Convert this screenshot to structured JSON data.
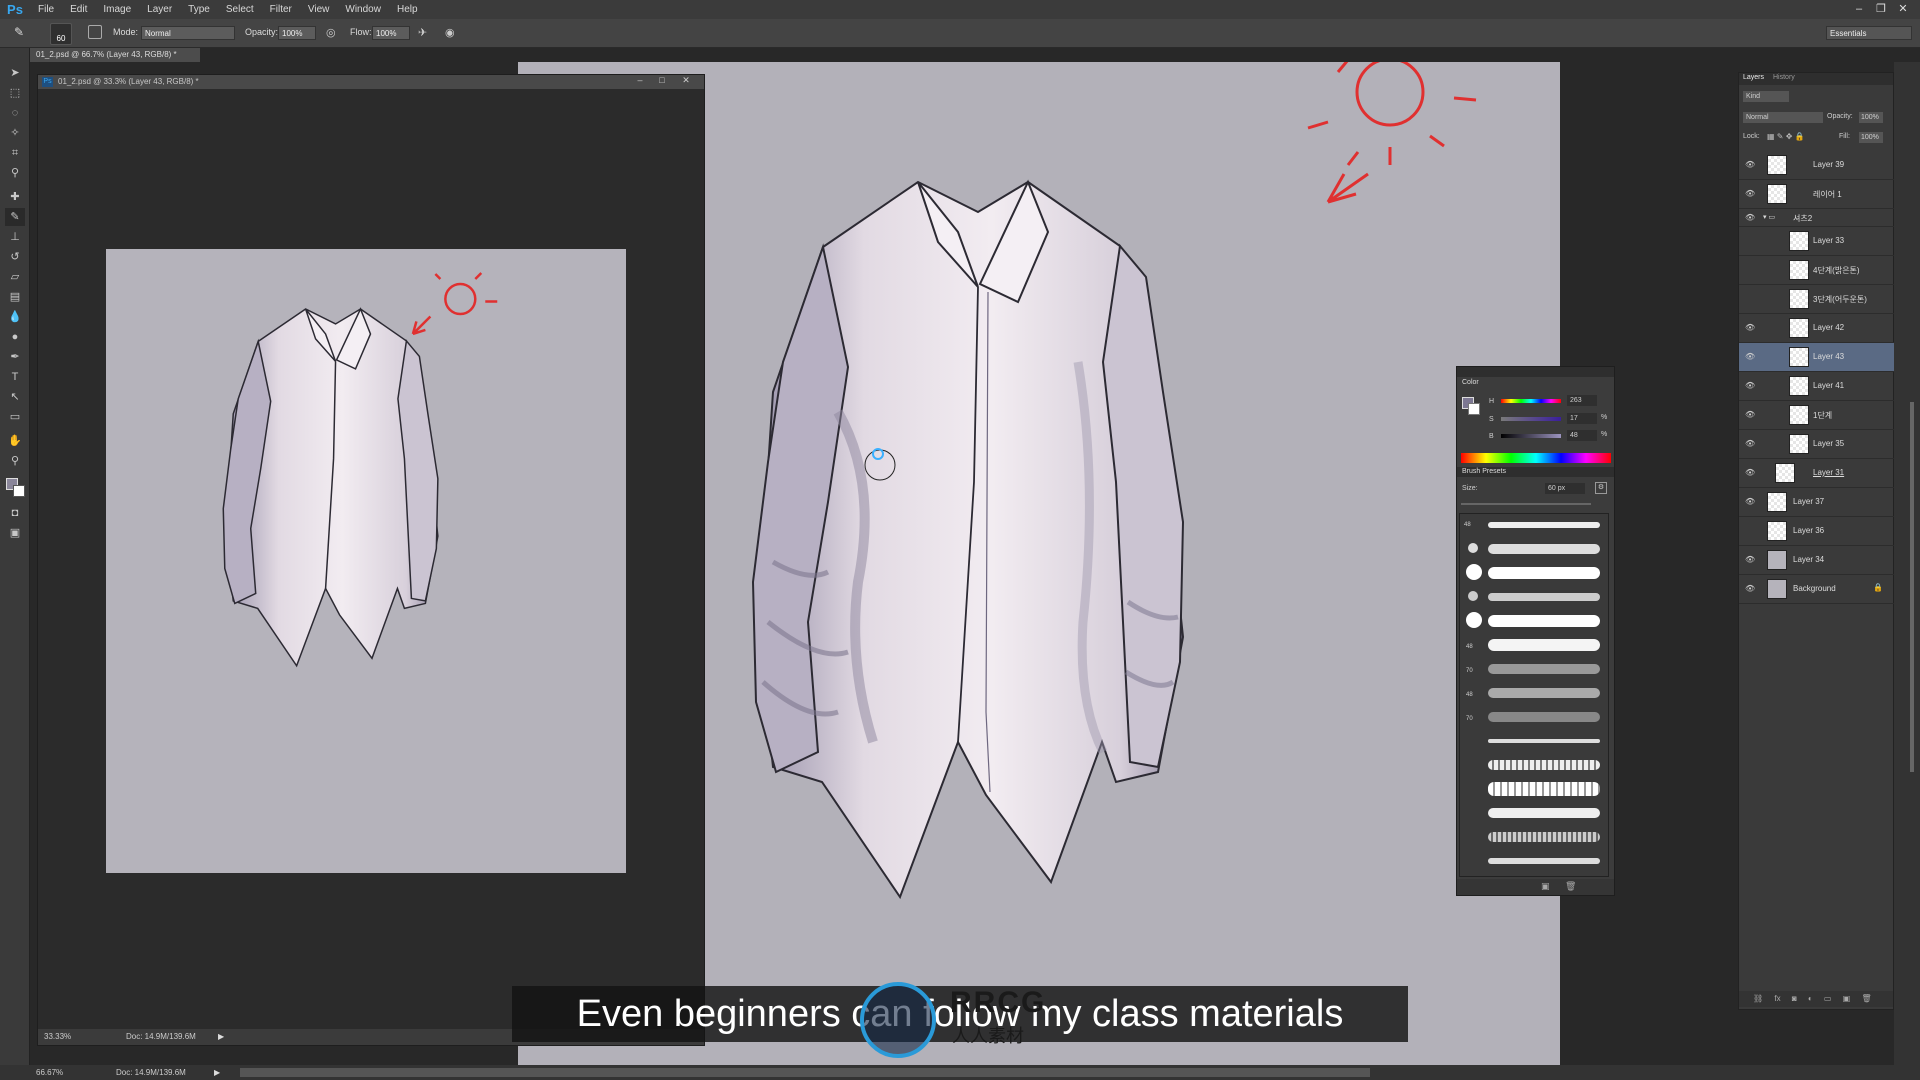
{
  "app": {
    "logo": "Ps"
  },
  "menu": [
    "File",
    "Edit",
    "Image",
    "Layer",
    "Type",
    "Select",
    "Filter",
    "View",
    "Window",
    "Help"
  ],
  "window_controls": [
    "–",
    "❐",
    "✕"
  ],
  "options": {
    "brush_size": "60",
    "mode_label": "Mode:",
    "mode_value": "Normal",
    "opacity_label": "Opacity:",
    "opacity_value": "100%",
    "flow_label": "Flow:",
    "flow_value": "100%",
    "workspace": "Essentials"
  },
  "document": {
    "tab_title": "01_2.psd @ 66.7% (Layer 43, RGB/8) *",
    "float_title": "01_2.psd @ 33.3% (Layer 43, RGB/8) *",
    "float_zoom": "33.33%",
    "float_doc": "Doc: 14.9M/139.6M",
    "main_zoom": "66.67%",
    "main_doc": "Doc: 14.9M/139.6M"
  },
  "color_panel": {
    "title": "Color",
    "h_label": "H",
    "h_value": "263",
    "s_label": "S",
    "s_value": "17",
    "b_label": "B",
    "b_value": "48",
    "percent": "%"
  },
  "brush_panel": {
    "title": "Brush Presets",
    "size_label": "Size:",
    "size_value": "60 px",
    "numbers": [
      "48",
      "",
      "",
      "",
      "",
      "48",
      "",
      "70",
      "48",
      "70",
      "",
      "",
      "",
      "",
      "",
      ""
    ]
  },
  "layers_panel": {
    "tab_layers": "Layers",
    "tab_history": "History",
    "kind": "Kind",
    "blend": "Normal",
    "opacity_label": "Opacity:",
    "opacity_value": "100%",
    "lock_label": "Lock:",
    "fill_label": "Fill:",
    "fill_value": "100%",
    "layers": [
      {
        "name": "Layer 39"
      },
      {
        "name": "레이어 1"
      },
      {
        "name": "셔츠2"
      },
      {
        "name": "Layer 33"
      },
      {
        "name": "4단계(밝은톤)"
      },
      {
        "name": "3단계(어두운톤)"
      },
      {
        "name": "Layer 42"
      },
      {
        "name": "Layer 43"
      },
      {
        "name": "Layer 41"
      },
      {
        "name": "1단계"
      },
      {
        "name": "Layer 35"
      },
      {
        "name": "Layer 31"
      },
      {
        "name": "Layer 37"
      },
      {
        "name": "Layer 36"
      },
      {
        "name": "Layer 34"
      },
      {
        "name": "Background"
      }
    ]
  },
  "subtitle": "Even beginners can follow my class materials",
  "watermark": {
    "text": "RRCG",
    "sub": "人人素材"
  },
  "colors": {
    "sun_red": "#e03030",
    "shirt": "#ece6ec",
    "shadow": "#8a849a",
    "ps_blue": "#38a8f0"
  }
}
